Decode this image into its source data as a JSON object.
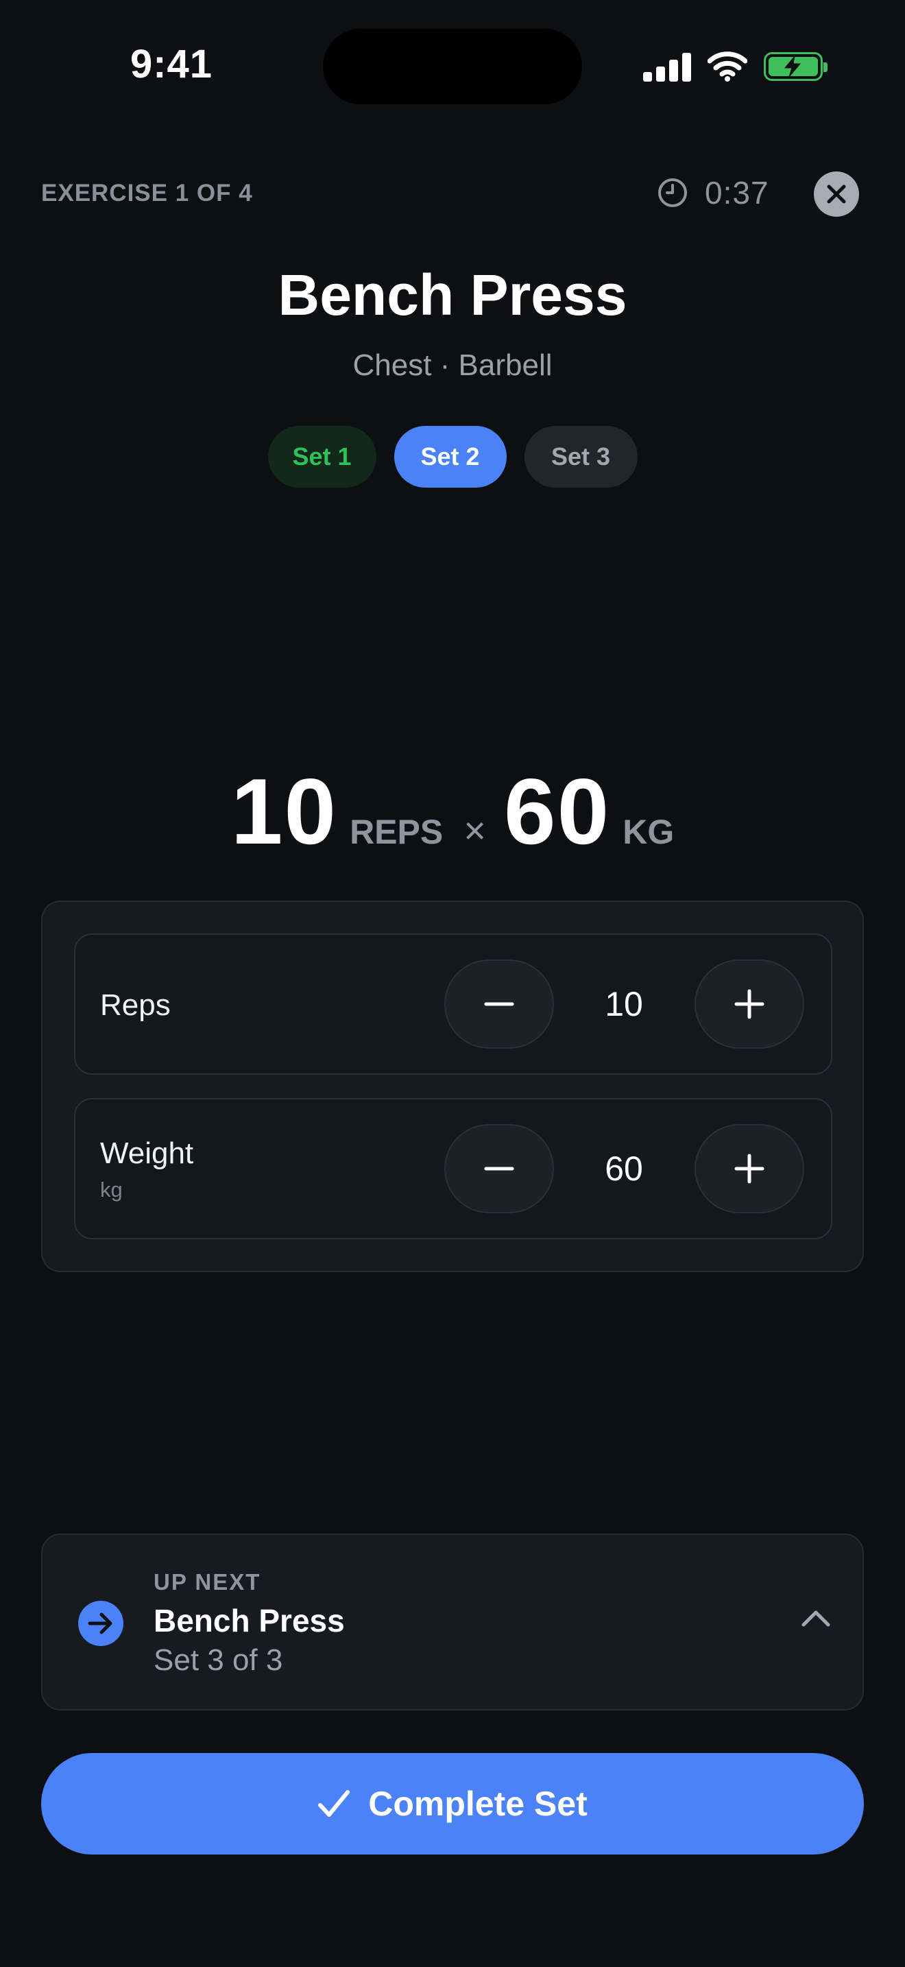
{
  "status_bar": {
    "time": "9:41",
    "icons": [
      "cellular-signal-icon",
      "wifi-icon",
      "battery-charging-icon"
    ],
    "battery_color": "#3fbf5c"
  },
  "header": {
    "exercise_counter": "EXERCISE 1 OF 4",
    "timer": "0:37",
    "timer_icon": "clock-icon",
    "close_icon": "close-icon"
  },
  "exercise": {
    "title": "Bench Press",
    "subtitle": "Chest · Barbell",
    "sets": [
      {
        "label": "Set 1",
        "state": "completed"
      },
      {
        "label": "Set 2",
        "state": "active"
      },
      {
        "label": "Set 3",
        "state": "upcoming"
      }
    ]
  },
  "summary": {
    "reps": "10",
    "reps_unit": "REPS",
    "separator": "×",
    "weight": "60",
    "weight_unit": "KG"
  },
  "adjust": {
    "reps": {
      "label": "Reps",
      "value": "10"
    },
    "weight": {
      "label": "Weight",
      "unit": "kg",
      "value": "60"
    }
  },
  "up_next": {
    "kicker": "UP NEXT",
    "title": "Bench Press",
    "subtitle": "Set 3 of 3"
  },
  "complete_button": {
    "label": "Complete Set",
    "icon": "checkmark-icon"
  },
  "colors": {
    "accent": "#4c82f7",
    "success": "#2fc25b",
    "background": "#0e0f13"
  }
}
